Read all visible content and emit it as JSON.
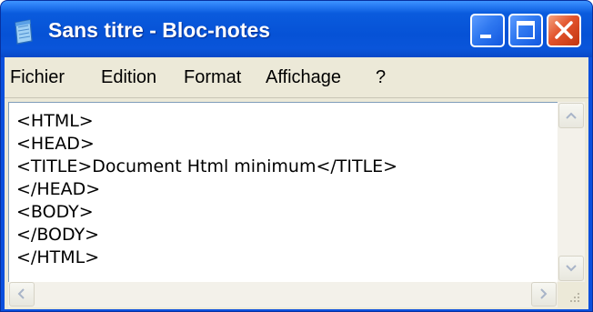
{
  "window": {
    "title": "Sans titre - Bloc-notes",
    "title_color": "#ffffff",
    "titlebar_color": "#0652d6",
    "close_button_color": "#e2532c"
  },
  "icons": {
    "app": "notepad-icon",
    "minimize": "minimize-icon",
    "maximize": "maximize-icon",
    "close": "close-icon",
    "scroll_up": "chevron-up-icon",
    "scroll_down": "chevron-down-icon",
    "scroll_left": "chevron-left-icon",
    "scroll_right": "chevron-right-icon",
    "resize": "resize-grip-icon"
  },
  "menu": {
    "items": [
      {
        "label": "Fichier"
      },
      {
        "label": "Edition"
      },
      {
        "label": "Format"
      },
      {
        "label": "Affichage"
      },
      {
        "label": "?"
      }
    ]
  },
  "editor": {
    "lines": [
      "<HTML>",
      "<HEAD>",
      "<TITLE>Document Html minimum</TITLE>",
      "</HEAD>",
      "<BODY>",
      "</BODY>",
      "</HTML>"
    ]
  }
}
